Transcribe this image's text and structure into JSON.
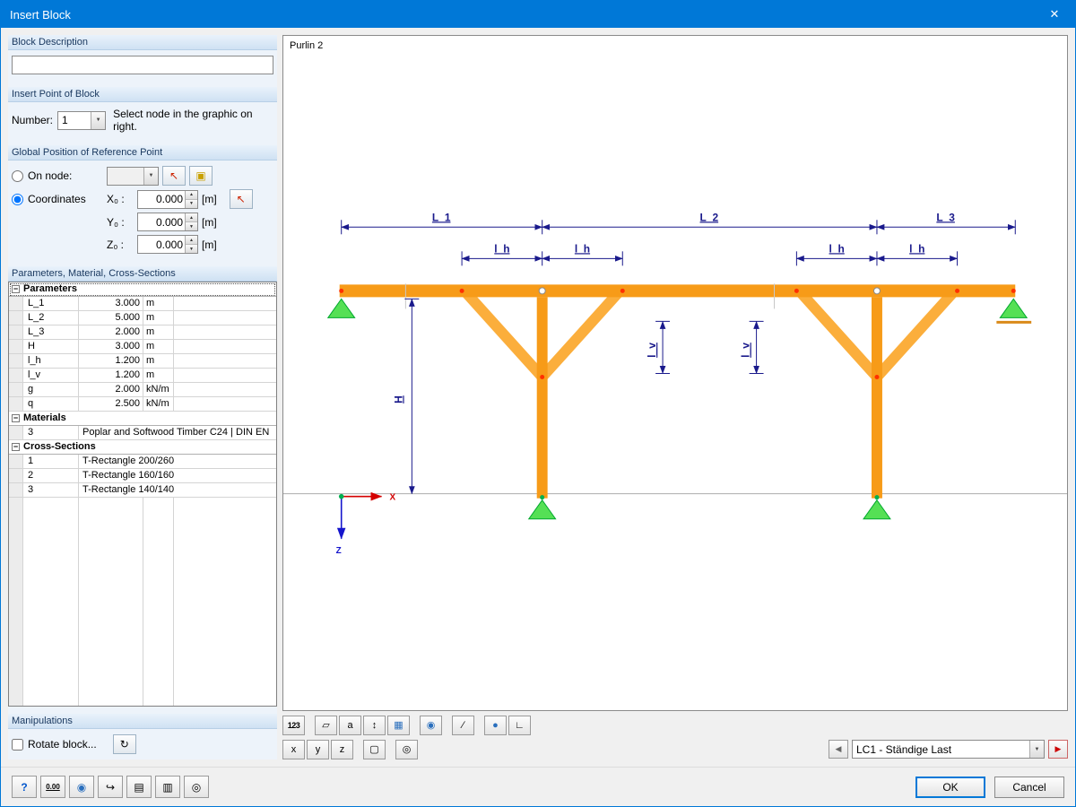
{
  "dialog": {
    "title": "Insert Block"
  },
  "block_description": {
    "header": "Block Description",
    "value": ""
  },
  "insert_point": {
    "header": "Insert Point of Block",
    "number_label": "Number:",
    "number_value": "1",
    "hint": "Select node in the graphic on right."
  },
  "global_position": {
    "header": "Global Position of Reference Point",
    "on_node": "On node:",
    "node_value": "",
    "coordinates": "Coordinates",
    "x_label": "X₀ :",
    "y_label": "Y₀ :",
    "z_label": "Z₀ :",
    "x_value": "0.000",
    "y_value": "0.000",
    "z_value": "0.000",
    "unit": "[m]"
  },
  "parameters": {
    "header": "Parameters, Material, Cross-Sections",
    "rows": [
      {
        "kind": "group",
        "label": "Parameters"
      },
      {
        "kind": "param",
        "name": "L_1",
        "value": "3.000",
        "unit": "m"
      },
      {
        "kind": "param",
        "name": "L_2",
        "value": "5.000",
        "unit": "m"
      },
      {
        "kind": "param",
        "name": "L_3",
        "value": "2.000",
        "unit": "m"
      },
      {
        "kind": "param",
        "name": "H",
        "value": "3.000",
        "unit": "m"
      },
      {
        "kind": "param",
        "name": "l_h",
        "value": "1.200",
        "unit": "m"
      },
      {
        "kind": "param",
        "name": "l_v",
        "value": "1.200",
        "unit": "m"
      },
      {
        "kind": "param",
        "name": "g",
        "value": "2.000",
        "unit": "kN/m"
      },
      {
        "kind": "param",
        "name": "q",
        "value": "2.500",
        "unit": "kN/m"
      },
      {
        "kind": "group",
        "label": "Materials"
      },
      {
        "kind": "wide",
        "name": "3",
        "value": "Poplar and Softwood Timber C24 | DIN EN"
      },
      {
        "kind": "group",
        "label": "Cross-Sections"
      },
      {
        "kind": "wide",
        "name": "1",
        "value": "T-Rectangle 200/260"
      },
      {
        "kind": "wide",
        "name": "2",
        "value": "T-Rectangle 160/160"
      },
      {
        "kind": "wide",
        "name": "3",
        "value": "T-Rectangle 140/140"
      }
    ]
  },
  "manipulations": {
    "header": "Manipulations",
    "rotate_label": "Rotate block..."
  },
  "graphics": {
    "caption": "Purlin 2",
    "labels": {
      "L1": "L_1",
      "L2": "L_2",
      "L3": "L_3",
      "lh": "l_h",
      "lv": "l_v",
      "H": "H",
      "x_axis": "X",
      "z_axis": "Z"
    },
    "load_case": "LC1 - Ständige Last"
  },
  "footer": {
    "ok": "OK",
    "cancel": "Cancel"
  },
  "icons": {
    "close": "✕",
    "dropdown": "▼",
    "spin_up": "▲",
    "spin_down": "▼",
    "collapse": "−",
    "pick_node": "↖",
    "new_node": "▣",
    "pick_point": "↖",
    "rotate": "↻",
    "help": "?",
    "decimals": "0.00",
    "units": "◉",
    "import": "↪",
    "copy": "▤",
    "paste": "▥",
    "details": "◎",
    "numbering": "123",
    "view_iso": "▱",
    "text_size": "a",
    "dim_lines": "↕",
    "render": "▦",
    "visibility": "◉",
    "section": "∕",
    "solid": "●",
    "angle": "∟",
    "axis_x": "x",
    "axis_y": "y",
    "axis_z": "z",
    "wire_cube": "▢",
    "zoom_off": "◎",
    "prev": "◀",
    "next": "▶"
  },
  "colors": {
    "accent": "#0078d7",
    "member_orange": "#f79b18",
    "brace_orange": "#fbae3c",
    "support_green": "#55e055",
    "dimension_navy": "#1a1a8c",
    "axis_x_red": "#d40000",
    "axis_z_blue": "#1414cc"
  }
}
